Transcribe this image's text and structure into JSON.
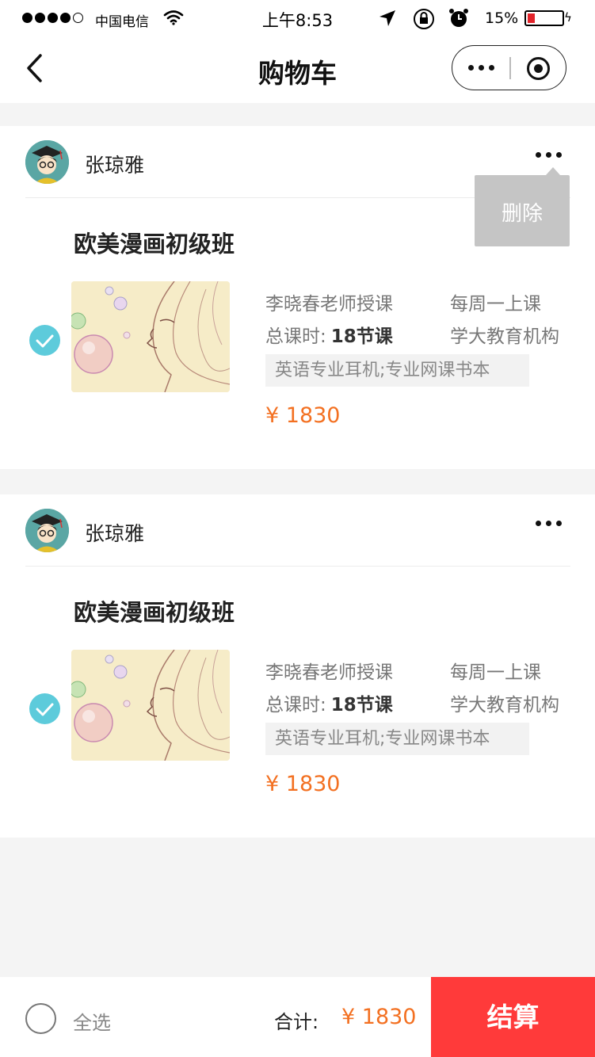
{
  "status_bar": {
    "carrier": "中国电信",
    "time": "上午8:53",
    "battery_percent": "15%",
    "battery_level": 0.15
  },
  "nav": {
    "title": "购物车"
  },
  "cart_items": [
    {
      "seller": "张琼雅",
      "course_title": "欧美漫画初级班",
      "teacher": "李晓春老师授课",
      "schedule": "每周一上课",
      "hours_label": "总课时:",
      "hours_value": "18节课",
      "institution": "学大教育机构",
      "tags": "英语专业耳机;专业网课书本",
      "price": "¥ 1830",
      "checked": true
    },
    {
      "seller": "张琼雅",
      "course_title": "欧美漫画初级班",
      "teacher": "李晓春老师授课",
      "schedule": "每周一上课",
      "hours_label": "总课时:",
      "hours_value": "18节课",
      "institution": "学大教育机构",
      "tags": "英语专业耳机;专业网课书本",
      "price": "¥ 1830",
      "checked": true
    }
  ],
  "popup": {
    "delete_label": "删除"
  },
  "footer": {
    "select_all_label": "全选",
    "total_label": "合计:",
    "total_value": "¥ 1830",
    "checkout_label": "结算"
  },
  "colors": {
    "accent_orange": "#f37021",
    "checkout_red": "#ff3a3a",
    "check_teal": "#5dcbdb"
  }
}
